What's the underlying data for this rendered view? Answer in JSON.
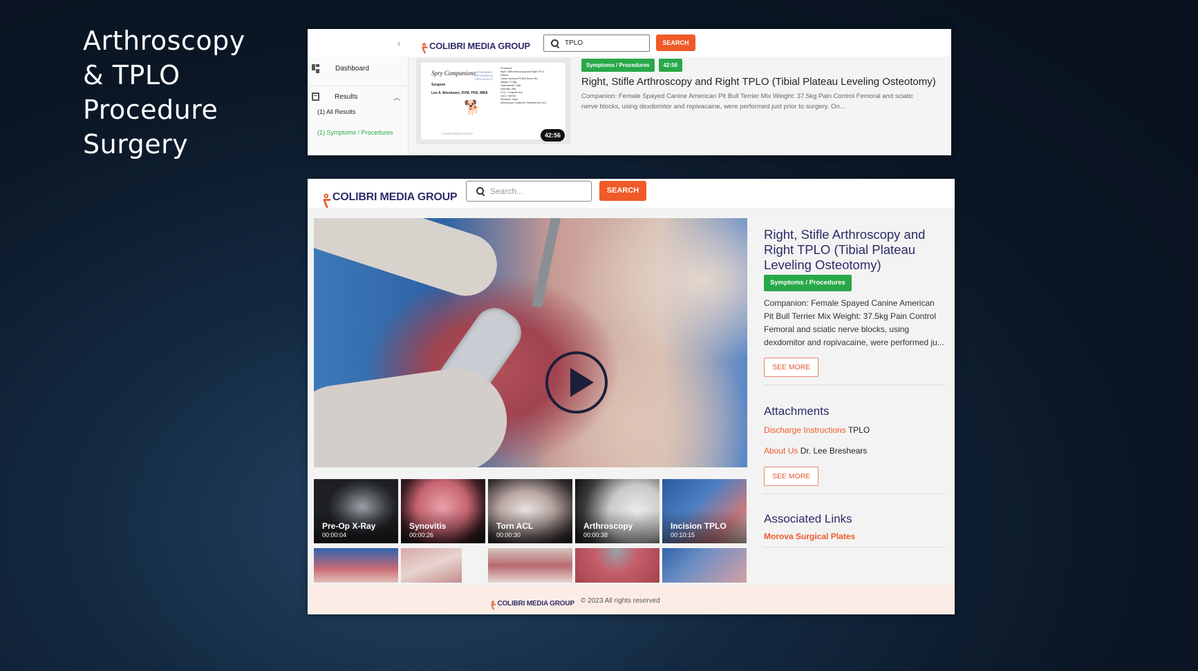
{
  "slide": {
    "title_lines": [
      "Arthroscopy",
      "& TPLO",
      "Procedure",
      "Surgery"
    ]
  },
  "brand": {
    "logo_text": "COLIBRI MEDIA GROUP",
    "accent": "#ef5a28",
    "navy": "#2b2a66",
    "green": "#29a849"
  },
  "top_screen": {
    "collapse_icon": "chevron-left-icon",
    "search_value": "TPLO",
    "search_button": "SEARCH",
    "sidebar": {
      "dashboard": "Dashboard",
      "results": "Results",
      "all_results": "(1) All Results",
      "symptoms": "(1) Symptoms / Procedures"
    },
    "result": {
      "thumb": {
        "brand": "Spry Companions",
        "brand_sub": "VETERINARY ORTHOPEDIC SPECIALISTS",
        "surgeon_label": "Surgeon",
        "surgeon": "Lee A. Breshears, DVM, PhD, MBA",
        "lines": [
          "Procedure:",
          "Right, Stifle Arthroscopy and Right TPLO",
          "Patient:",
          "Canine America Pit Bull Terrier Mix",
          "Weight: 37.5kg",
          "Osteoarthritis: Mild",
          "Synovitis: Mild",
          "CrCL: Complete tear",
          "CaCL: Normal",
          "Meniscus: Intact",
          "Arthroscopic Treatment: Debrided torn ACL"
        ],
        "footer": "COLIBRI MEDIA GROUP"
      },
      "duration": "42:56",
      "tag": "Symptoms / Procedures",
      "tag_duration": "42:56",
      "title": "Right, Stifle Arthroscopy and Right TPLO (Tibial Plateau Leveling Osteotomy)",
      "description": "Companion: Female Spayed Canine American Pit Bull Terrier Mix Weight: 37.5kg Pain Control Femoral and sciatic nerve blocks, using dexdomitor and ropivacaine, were performed just prior to surgery. On..."
    }
  },
  "bottom_screen": {
    "search_placeholder": "Search...",
    "search_button": "SEARCH",
    "title": "Right, Stifle Arthroscopy and Right TPLO (Tibial Plateau Leveling Osteotomy)",
    "tag": "Symptoms / Procedures",
    "description": "Companion: Female Spayed Canine American Pit Bull Terrier Mix Weight: 37.5kg Pain Control Femoral and sciatic nerve blocks, using dexdomitor and ropivacaine, were performed ju...",
    "see_more": "SEE MORE",
    "attachments_heading": "Attachments",
    "attachments": [
      {
        "link": "Discharge Instructions",
        "text": " TPLO"
      },
      {
        "link": "About Us",
        "text": " Dr. Lee Breshears"
      }
    ],
    "attachments_see_more": "SEE MORE",
    "associated_heading": "Associated Links",
    "associated_links": [
      "Morova Surgical Plates"
    ],
    "chapters": [
      {
        "name": "Pre-Op X-Ray",
        "time": "00:00:04"
      },
      {
        "name": "Synovitis",
        "time": "00:00:26"
      },
      {
        "name": "Torn ACL",
        "time": "00:00:30"
      },
      {
        "name": "Arthroscopy",
        "time": "00:00:38"
      },
      {
        "name": "Incision TPLO",
        "time": "00:10:15"
      }
    ],
    "footer_copy": "© 2023 All rights reserved"
  }
}
